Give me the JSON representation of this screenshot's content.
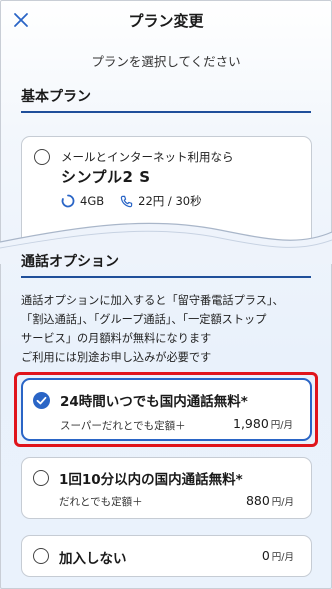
{
  "header": {
    "title": "プラン変更",
    "close_icon": "close-icon"
  },
  "subtitle": "プランを選択してください",
  "basic_plan": {
    "heading": "基本プラン",
    "card": {
      "description": "メールとインターネット利用なら",
      "name": "シンプル2 S",
      "data": "4GB",
      "call_rate": "22円 / 30秒",
      "data_icon": "data-gauge-icon",
      "call_icon": "phone-icon"
    }
  },
  "call_options": {
    "heading": "通話オプション",
    "description_lines": [
      "通話オプションに加入すると「留守番電話プラス」、",
      "「割込通話」、「グループ通話」、「一定額ストップ",
      "サービス」の月額料が無料になります",
      "ご利用には別途お申し込みが必要です"
    ],
    "options": [
      {
        "title": "24時間いつでも国内通話無料*",
        "sub": "スーパーだれとでも定額＋",
        "price": "1,980",
        "unit": "円/月",
        "selected": true
      },
      {
        "title": "1回10分以内の国内通話無料*",
        "sub": "だれとでも定額＋",
        "price": "880",
        "unit": "円/月",
        "selected": false
      },
      {
        "title": "加入しない",
        "sub": "",
        "price": "0",
        "unit": "円/月",
        "selected": false
      }
    ]
  },
  "colors": {
    "accent": "#2a65c6",
    "heading_rule": "#1f4f9a",
    "highlight": "#e0141b"
  }
}
